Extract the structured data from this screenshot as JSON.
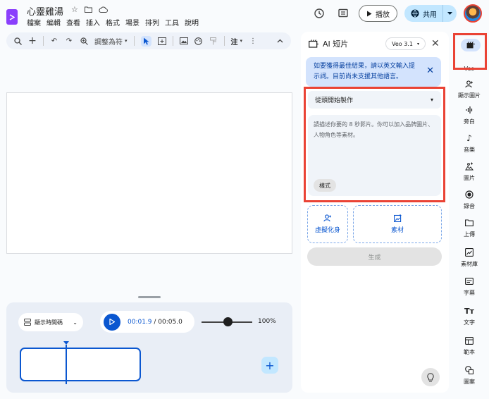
{
  "app": {
    "title": "心靈雞湯",
    "menu": [
      "檔案",
      "編輯",
      "查看",
      "插入",
      "格式",
      "場景",
      "排列",
      "工具",
      "說明"
    ]
  },
  "header": {
    "play_label": "播放",
    "share_label": "共用"
  },
  "toolbar": {
    "fit_label": "調整為符",
    "comment_label": "注"
  },
  "timeline": {
    "timecode_toggle_label": "顯示時間碼",
    "current_time": "00:01.9",
    "duration": "/ 00:05.0",
    "zoom": "100%",
    "zoom_fraction": 0.55
  },
  "ai_panel": {
    "title": "AI 短片",
    "model": "Veo 3.1",
    "notice": "如要獲得最佳結果，請以英文輸入提示詞。目前尚未支援其他語言。",
    "start_mode": "從頭開始製作",
    "prompt_placeholder": "請描述你要的 8 秒影片。你可以加入品牌圖片、人物角色等素材。",
    "style_chip": "樣式",
    "avatar_tile": "虛擬化身",
    "assets_tile": "素材",
    "generate_label": "生成"
  },
  "rail": {
    "items": [
      {
        "label": "Veo",
        "icon": "veo-icon"
      },
      {
        "label": "顯示圖片",
        "icon": "person-add-icon"
      },
      {
        "label": "旁白",
        "icon": "waveform-icon"
      },
      {
        "label": "音樂",
        "icon": "music-note-icon"
      },
      {
        "label": "圖片",
        "icon": "image-sparkle-icon"
      },
      {
        "label": "錄音",
        "icon": "record-icon"
      },
      {
        "label": "上傳",
        "icon": "folder-icon"
      },
      {
        "label": "素材庫",
        "icon": "library-icon"
      },
      {
        "label": "字幕",
        "icon": "captions-icon"
      },
      {
        "label": "文字",
        "icon": "text-icon"
      },
      {
        "label": "範本",
        "icon": "template-icon"
      },
      {
        "label": "圖案",
        "icon": "shapes-icon"
      }
    ]
  },
  "colors": {
    "accent": "#0b57d0",
    "highlight": "#ea4335",
    "share_bg": "#c2e7ff"
  }
}
